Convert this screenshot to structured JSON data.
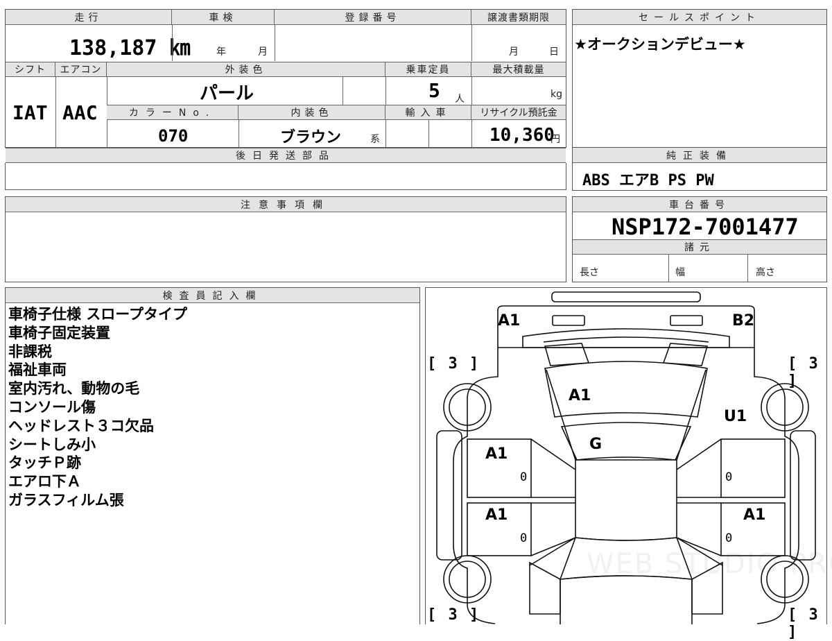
{
  "info": {
    "mileage_label": "走行",
    "mileage_value": "138,187 ㎞",
    "inspection_label": "車検",
    "inspection_year": "年",
    "inspection_month": "月",
    "registration_label": "登録番号",
    "transfer_label": "譲渡書類期限",
    "transfer_month": "月",
    "transfer_day": "日",
    "shift_label": "シフト",
    "ac_label": "エアコン",
    "exterior_color_label": "外装色",
    "capacity_label": "乗車定員",
    "max_load_label": "最大積載量",
    "shift_value": "IAT",
    "ac_value": "AAC",
    "exterior_color_value": "パール",
    "capacity_value": "5",
    "capacity_unit": "人",
    "max_load_unit": "kg",
    "color_no_label": "カラーNo.",
    "interior_color_label": "内装色",
    "import_label": "輸入車",
    "recycle_label": "リサイクル預託金",
    "color_no_value": "070",
    "interior_color_value": "ブラウン",
    "interior_color_suffix": "系",
    "recycle_value": "10,360",
    "recycle_unit": "円",
    "later_parts_label": "後日発送部品"
  },
  "sales": {
    "label": "セールスポイント",
    "text": "★オークションデビュー★"
  },
  "equipment": {
    "label": "純正装備",
    "text": "ABS エアB PS PW"
  },
  "caution": {
    "label": "注意事項欄"
  },
  "chassis": {
    "label": "車台番号",
    "value": "NSP172-7001477",
    "specs_label": "諸元",
    "length_label": "長さ",
    "width_label": "幅",
    "height_label": "高さ"
  },
  "inspector": {
    "label": "検査員記入欄",
    "lines": [
      "車椅子仕様 スロープタイプ",
      "車椅子固定装置",
      "非課税",
      "福祉車両",
      "室内汚れ、動物の毛",
      "コンソール傷",
      "ヘッドレスト３コ欠品",
      "シートしみ小",
      "タッチＰ跡",
      "エアロ下Ａ",
      "ガラスフィルム張"
    ]
  },
  "diagram": {
    "mark_front_left": "A1",
    "mark_front_right": "B2",
    "mark_hood": "A1",
    "mark_windshield": "G",
    "mark_right_fender": "U1",
    "mark_left_front_door": "A1",
    "mark_left_rear_door": "A1",
    "mark_right_rear_door": "A1",
    "zero": "0",
    "tire_bracket": "[ 3 ]",
    "watermark": "WEB STUDIO PRO"
  }
}
